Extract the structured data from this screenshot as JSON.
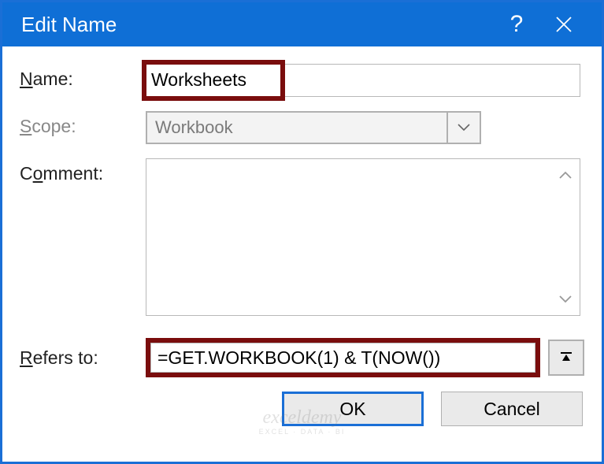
{
  "titlebar": {
    "title": "Edit Name"
  },
  "labels": {
    "name": "ame:",
    "name_prefix": "N",
    "scope": "cope:",
    "scope_prefix": "S",
    "comment": "omment:",
    "comment_prefix": "C",
    "refers": "efers to:",
    "refers_prefix": "R"
  },
  "fields": {
    "name_value": "Worksheets",
    "scope_value": "Workbook",
    "comment_value": "",
    "refers_value": "=GET.WORKBOOK(1) & T(NOW())"
  },
  "buttons": {
    "ok": "OK",
    "cancel": "Cancel"
  },
  "watermark": {
    "main": "exceldemy",
    "sub": "EXCEL · DATA · BI"
  }
}
